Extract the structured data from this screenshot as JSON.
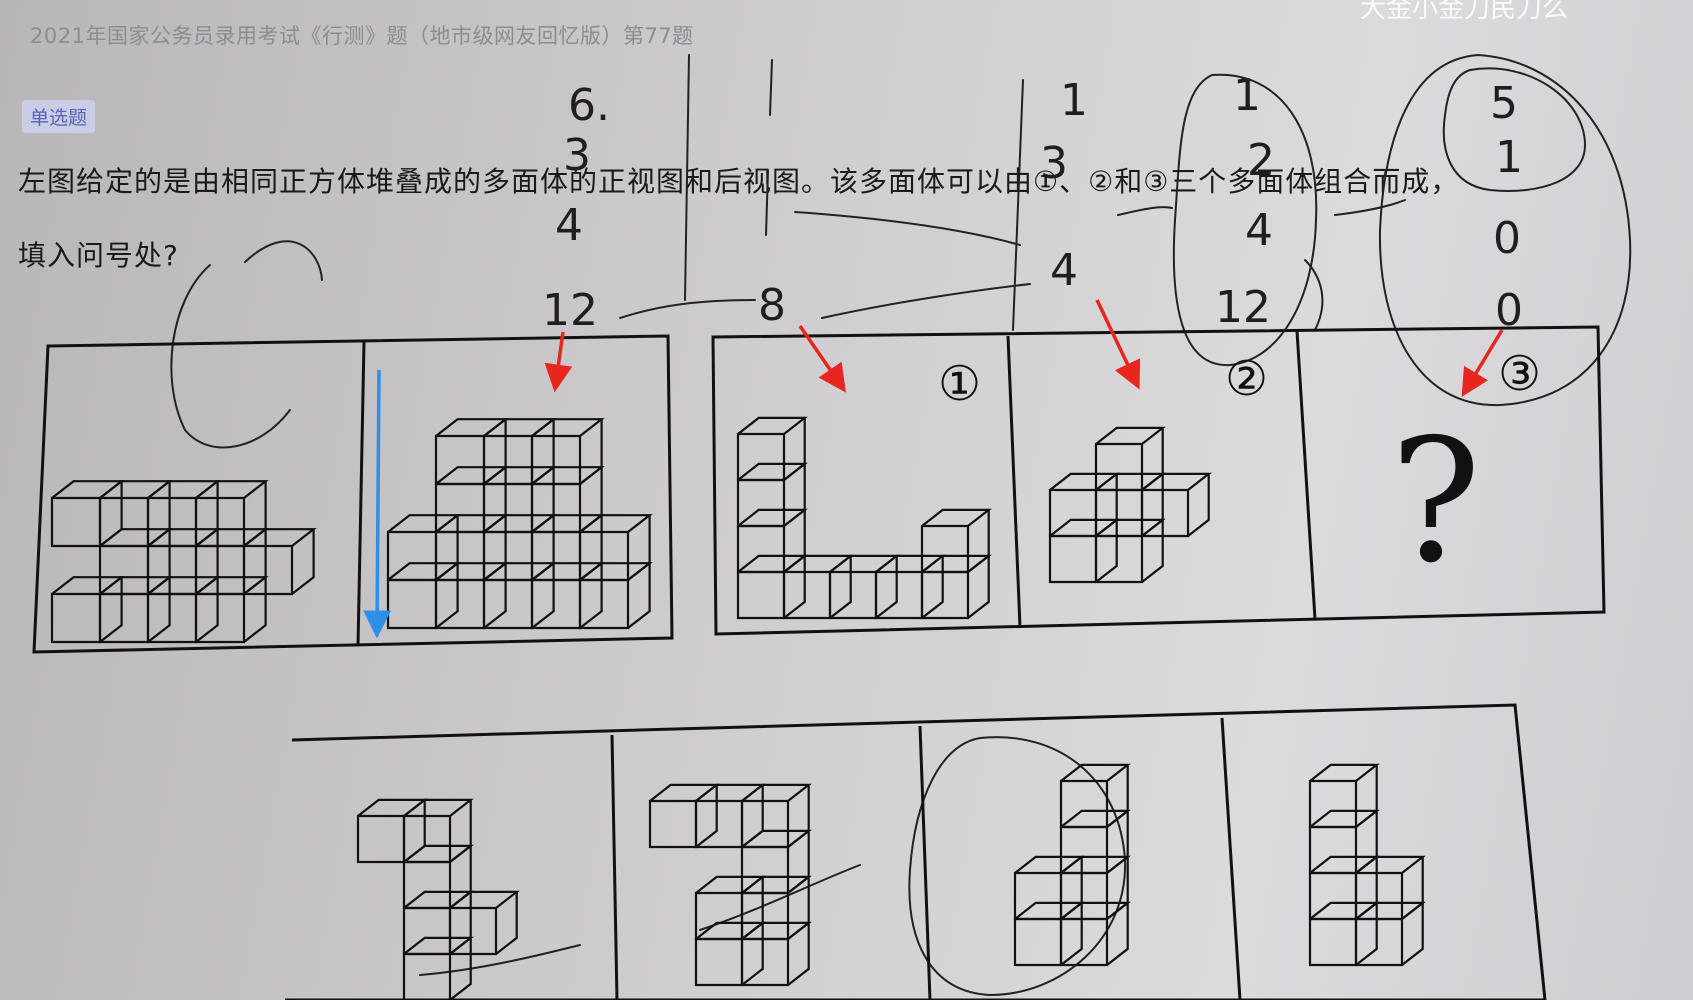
{
  "header": {
    "source": "2021年国家公务员录用考试《行测》题（地市级网友回忆版）第77题"
  },
  "question": {
    "type_badge": "单选题",
    "text_line1": "左图给定的是由相同正方体堆叠成的多面体的正视图和后视图。该多面体可以由①、②和③三个多面体组合而成，",
    "text_line2": "填入问号处?"
  },
  "overlay": {
    "top_right_partial": "大金小金刀民刀么"
  },
  "figure": {
    "piece_labels": [
      "①",
      "②",
      "③"
    ],
    "unknown_mark": "?"
  },
  "handwriting": {
    "col1": [
      "6.",
      "3",
      "4",
      "12"
    ],
    "col2": [
      "1",
      "1",
      "8"
    ],
    "col3": [
      "1",
      "3",
      "4",
      "4"
    ],
    "col4": [
      "1",
      "2",
      "4",
      "12"
    ],
    "col5": [
      "5",
      "1",
      "0",
      "0"
    ]
  },
  "colors": {
    "arrow_red": "#e8261d",
    "arrow_blue": "#2f8fe6",
    "ink": "#1a1a1a"
  },
  "icons": [
    "red-arrow-icon",
    "blue-arrow-icon",
    "question-mark-icon"
  ]
}
